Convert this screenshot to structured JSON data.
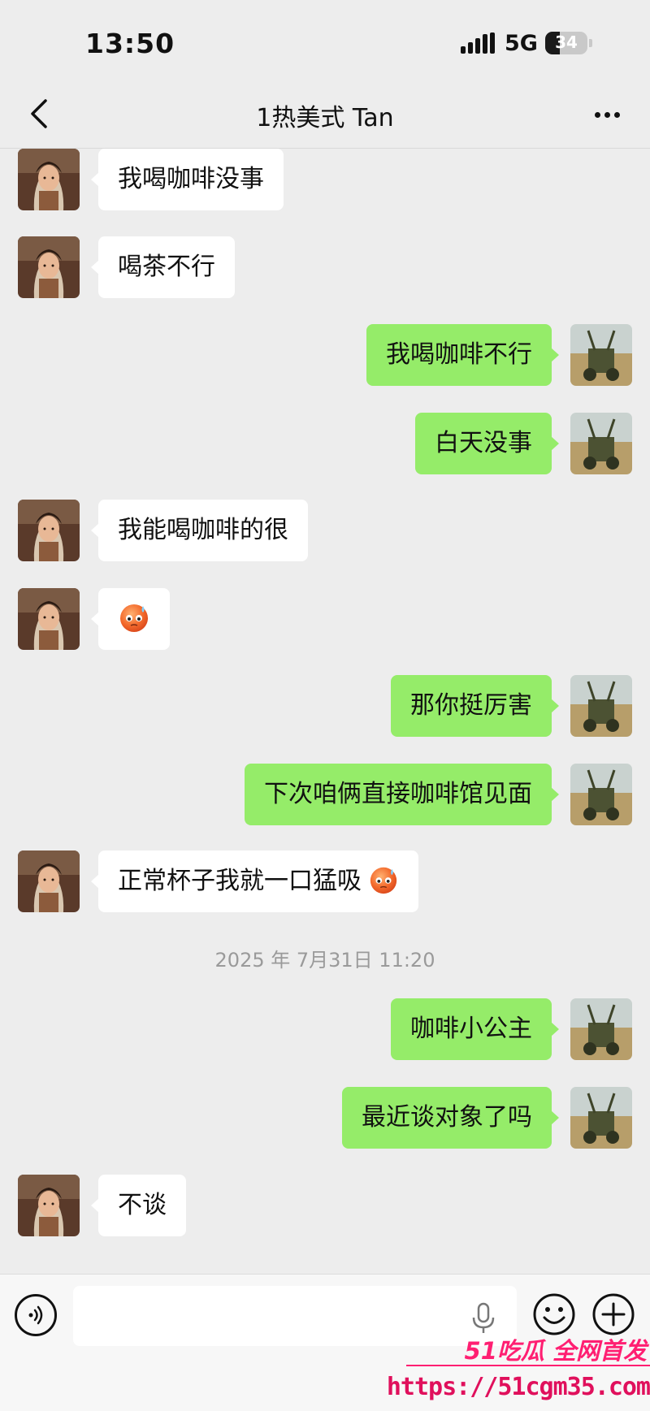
{
  "status_bar": {
    "time": "13:50",
    "network": "5G",
    "battery_level": 34,
    "battery_text": "34"
  },
  "header": {
    "title": "1热美式 Tan",
    "back_icon": "chevron-left-icon",
    "more_icon": "more-dots-icon"
  },
  "colors": {
    "background": "#ededed",
    "sent_bubble": "#95ec69",
    "received_bubble": "#ffffff",
    "watermark": "#ff1f72"
  },
  "messages": [
    {
      "side": "left",
      "text": "我喝咖啡没事"
    },
    {
      "side": "left",
      "text": "喝茶不行"
    },
    {
      "side": "right",
      "text": "我喝咖啡不行"
    },
    {
      "side": "right",
      "text": "白天没事"
    },
    {
      "side": "left",
      "text": "我能喝咖啡的很"
    },
    {
      "side": "left",
      "text": "",
      "emoji": "sweat-face-emoji"
    },
    {
      "side": "right",
      "text": "那你挺厉害"
    },
    {
      "side": "right",
      "text": "下次咱俩直接咖啡馆见面"
    },
    {
      "side": "left",
      "text": "正常杯子我就一口猛吸",
      "emoji": "sweat-face-emoji"
    },
    {
      "side": "right",
      "text": "咖啡小公主"
    },
    {
      "side": "right",
      "text": "最近谈对象了吗"
    },
    {
      "side": "left",
      "text": "不谈"
    }
  ],
  "timestamp": "2025 年 7月31日 11:20",
  "input_bar": {
    "placeholder": "",
    "voice_icon": "voice-icon",
    "mic_icon": "microphone-icon",
    "emoji_icon": "smiley-icon",
    "plus_icon": "plus-circle-icon"
  },
  "watermark": {
    "logo": "51吃瓜 全网首发",
    "url": "https://51cgm35.com"
  }
}
